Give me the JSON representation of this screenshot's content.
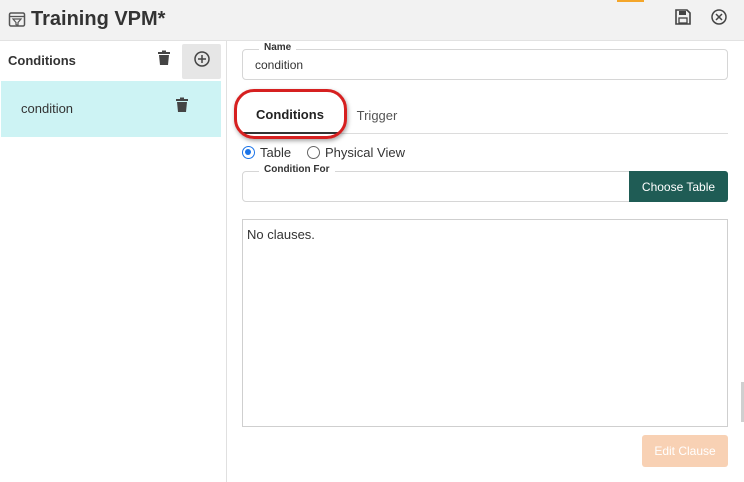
{
  "window": {
    "title": "Training VPM*",
    "save_icon": "save-icon",
    "close_icon": "close-circle-icon"
  },
  "sidebar": {
    "header_label": "Conditions",
    "delete_icon": "trash-icon",
    "add_icon": "add-circle-icon",
    "items": [
      {
        "label": "condition",
        "delete_icon": "trash-icon",
        "selected": true
      }
    ]
  },
  "form": {
    "name": {
      "label": "Name",
      "value": "condition"
    },
    "tabs": [
      {
        "label": "Conditions",
        "active": true
      },
      {
        "label": "Trigger",
        "active": false
      }
    ],
    "view_mode": {
      "options": [
        "Table",
        "Physical View"
      ],
      "selected": "Table"
    },
    "condition_for": {
      "label": "Condition For",
      "value": ""
    },
    "choose_table_label": "Choose Table",
    "clauses_text": "No clauses.",
    "edit_clause_label": "Edit Clause"
  },
  "colors": {
    "selected_row": "#cdf3f4",
    "primary_button": "#1f5c55",
    "disabled_button": "#f8d1b4",
    "radio_accent": "#1a73e8",
    "annotation_ring": "#d62020"
  }
}
